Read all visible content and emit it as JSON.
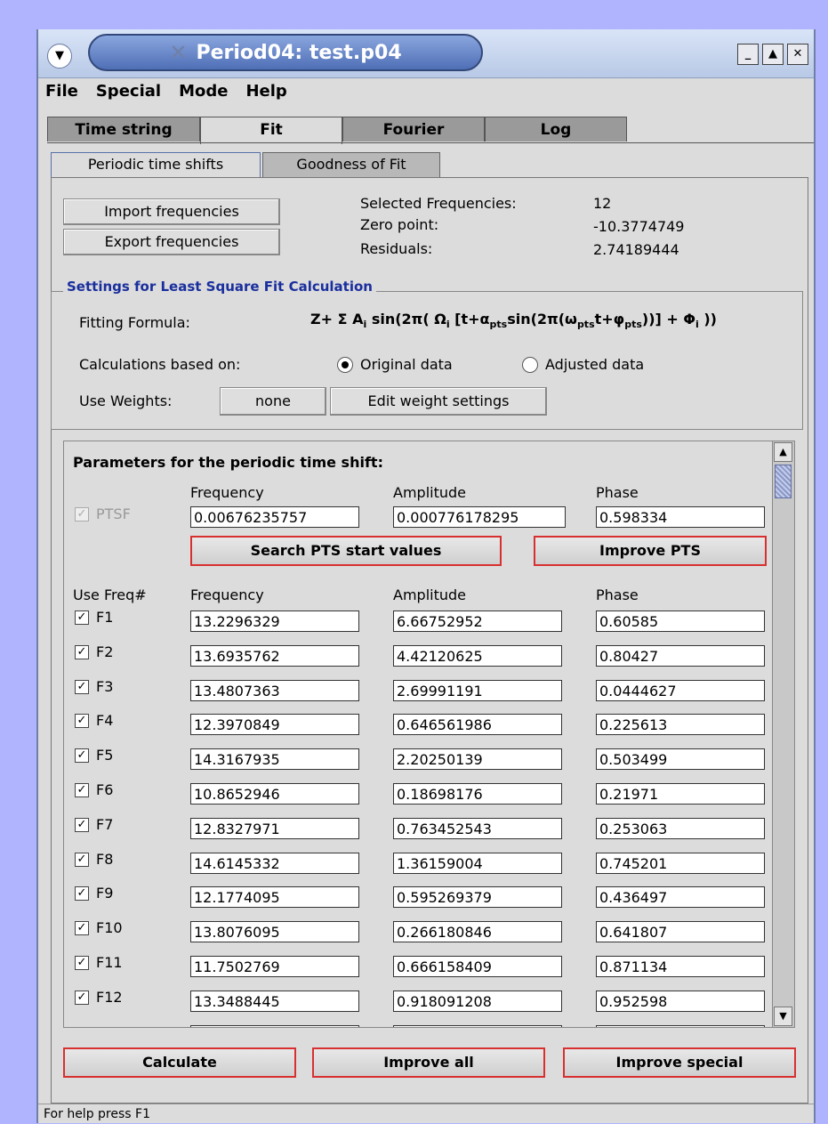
{
  "window": {
    "title": "Period04: test.p04"
  },
  "menubar": {
    "items": [
      "File",
      "Special",
      "Mode",
      "Help"
    ]
  },
  "tabs": [
    "Time string",
    "Fit",
    "Fourier",
    "Log"
  ],
  "subtabs": [
    "Periodic time shifts",
    "Goodness of Fit"
  ],
  "fit": {
    "import_btn": "Import frequencies",
    "export_btn": "Export frequencies",
    "selected_label": "Selected Frequencies:",
    "selected_value": "12",
    "zero_label": "Zero point:",
    "zero_value": "-10.3774749",
    "residuals_label": "Residuals:",
    "residuals_value": "2.74189444"
  },
  "settings": {
    "legend": "Settings for Least Square Fit Calculation",
    "formula_label": "Fitting Formula:",
    "calc_label": "Calculations based on:",
    "opt_original": "Original data",
    "opt_adjusted": "Adjusted data",
    "selected_option": "Original data",
    "weights_label": "Use Weights:",
    "weights_value": "none",
    "edit_weights_btn": "Edit weight settings"
  },
  "pts": {
    "heading": "Parameters for the periodic time shift:",
    "col_frequency": "Frequency",
    "col_amplitude": "Amplitude",
    "col_phase": "Phase",
    "checkbox_label": "PTSF",
    "frequency": "0.00676235757",
    "amplitude": "0.000776178295",
    "phase": "0.598334",
    "search_btn": "Search PTS start values",
    "improve_btn": "Improve PTS"
  },
  "freq_table": {
    "col_use": "Use Freq#",
    "col_frequency": "Frequency",
    "col_amplitude": "Amplitude",
    "col_phase": "Phase",
    "rows": [
      {
        "label": "F1",
        "frequency": "13.2296329",
        "amplitude": "6.66752952",
        "phase": "0.60585"
      },
      {
        "label": "F2",
        "frequency": "13.6935762",
        "amplitude": "4.42120625",
        "phase": "0.80427"
      },
      {
        "label": "F3",
        "frequency": "13.4807363",
        "amplitude": "2.69991191",
        "phase": "0.0444627"
      },
      {
        "label": "F4",
        "frequency": "12.3970849",
        "amplitude": "0.646561986",
        "phase": "0.225613"
      },
      {
        "label": "F5",
        "frequency": "14.3167935",
        "amplitude": "2.20250139",
        "phase": "0.503499"
      },
      {
        "label": "F6",
        "frequency": "10.8652946",
        "amplitude": "0.18698176",
        "phase": "0.21971"
      },
      {
        "label": "F7",
        "frequency": "12.8327971",
        "amplitude": "0.763452543",
        "phase": "0.253063"
      },
      {
        "label": "F8",
        "frequency": "14.6145332",
        "amplitude": "1.36159004",
        "phase": "0.745201"
      },
      {
        "label": "F9",
        "frequency": "12.1774095",
        "amplitude": "0.595269379",
        "phase": "0.436497"
      },
      {
        "label": "F10",
        "frequency": "13.8076095",
        "amplitude": "0.266180846",
        "phase": "0.641807"
      },
      {
        "label": "F11",
        "frequency": "11.7502769",
        "amplitude": "0.666158409",
        "phase": "0.871134"
      },
      {
        "label": "F12",
        "frequency": "13.3488445",
        "amplitude": "0.918091208",
        "phase": "0.952598"
      }
    ]
  },
  "actions": {
    "calculate": "Calculate",
    "improve_all": "Improve all",
    "improve_special": "Improve special"
  },
  "status": "For help press F1"
}
